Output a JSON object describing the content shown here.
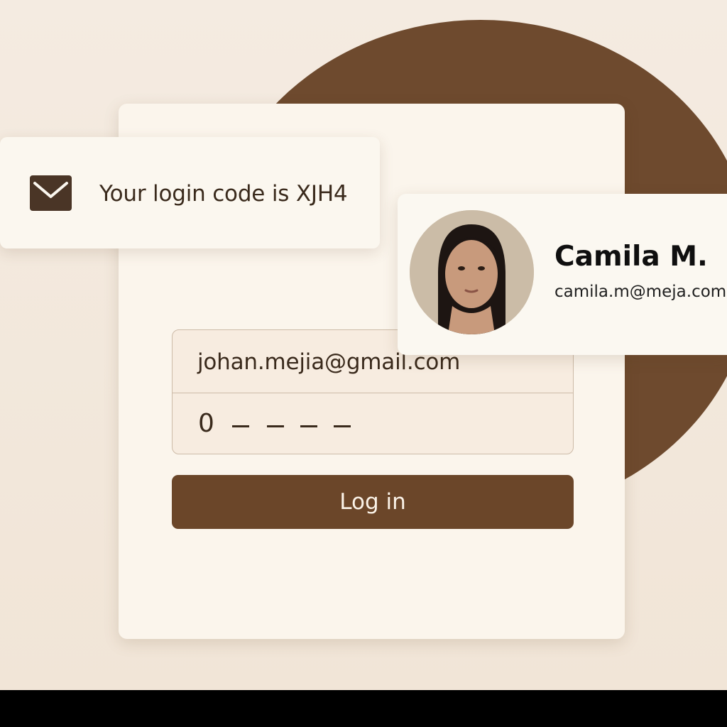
{
  "notification": {
    "icon": "mail-icon",
    "text": "Your login code is XJH4"
  },
  "profile": {
    "name": "Camila M.",
    "email": "camila.m@meja.com"
  },
  "login_form": {
    "email_value": "johan.mejia@gmail.com",
    "code_first_digit": "0",
    "code_placeholder_count": 4,
    "button_label": "Log in"
  },
  "colors": {
    "background": "#f2e8dc",
    "accent_brown": "#6e4a2e",
    "card": "#fbf5ec",
    "text_dark": "#3a2a1c"
  }
}
